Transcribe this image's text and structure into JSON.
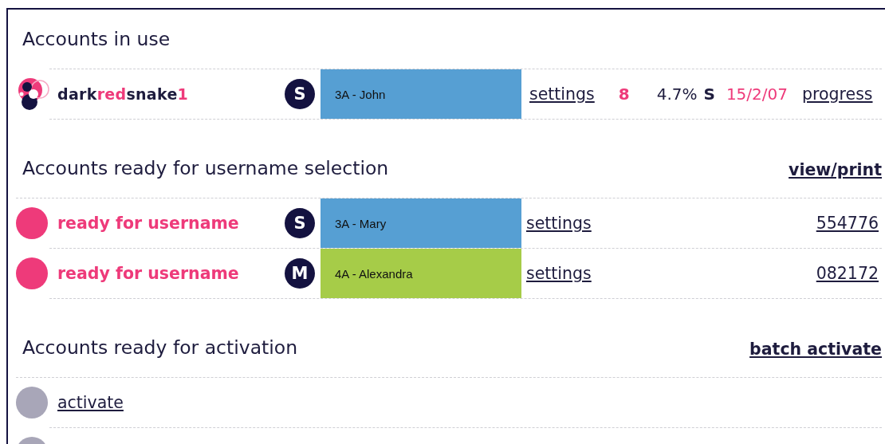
{
  "sections": [
    {
      "title": "Accounts in use",
      "rows": [
        {
          "kind": "account",
          "username_parts": [
            {
              "text": "dark",
              "highlight": false
            },
            {
              "text": "red",
              "highlight": true
            },
            {
              "text": "snake",
              "highlight": false
            },
            {
              "text": "1",
              "highlight": true
            }
          ],
          "badge": "S",
          "class_label": "3A - John",
          "color": "#569fd3",
          "settings": "settings",
          "count": "8",
          "percent": "4.7%",
          "grade": "S",
          "date": "15/2/07",
          "progress": "progress"
        }
      ]
    },
    {
      "title": "Accounts ready for username selection",
      "action": "view/print",
      "rows": [
        {
          "kind": "ready",
          "status": "ready for username",
          "badge": "S",
          "class_label": "3A - Mary",
          "color": "#569fd3",
          "settings": "settings",
          "code": "554776"
        },
        {
          "kind": "ready",
          "status": "ready for username",
          "badge": "M",
          "class_label": "4A - Alexandra",
          "color": "#a6cc48",
          "settings": "settings",
          "code": "082172"
        }
      ]
    },
    {
      "title": "Accounts ready for activation",
      "action": "batch activate",
      "rows": [
        {
          "kind": "pending",
          "link": "activate"
        },
        {
          "kind": "pending"
        }
      ]
    }
  ]
}
